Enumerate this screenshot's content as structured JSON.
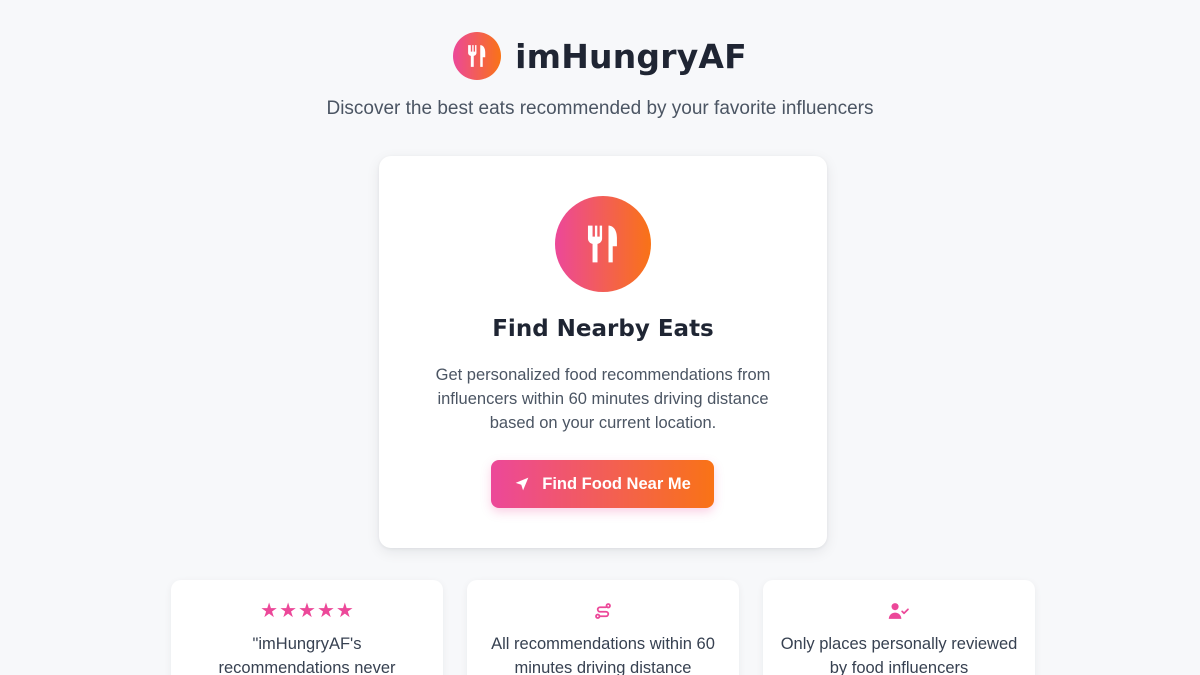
{
  "header": {
    "brand_name": "imHungryAF",
    "logo_icon": "utensils-icon",
    "tagline": "Discover the best eats recommended by your favorite influencers"
  },
  "main_card": {
    "icon": "utensils-icon",
    "title": "Find Nearby Eats",
    "description": "Get personalized food recommendations from influencers within 60 minutes driving distance based on your current location.",
    "button": {
      "icon": "location-arrow-icon",
      "label": "Find Food Near Me"
    }
  },
  "features": [
    {
      "icon": "five-stars-icon",
      "text": "\"imHungryAF's recommendations never"
    },
    {
      "icon": "route-icon",
      "text": "All recommendations within 60 minutes driving distance"
    },
    {
      "icon": "user-check-icon",
      "text": "Only places personally reviewed by food influencers"
    }
  ],
  "colors": {
    "gradient_start": "#ec4899",
    "gradient_end": "#f97316",
    "background": "#f7f8fa",
    "card": "#ffffff",
    "heading": "#1f2533",
    "body_text": "#4b5563"
  }
}
